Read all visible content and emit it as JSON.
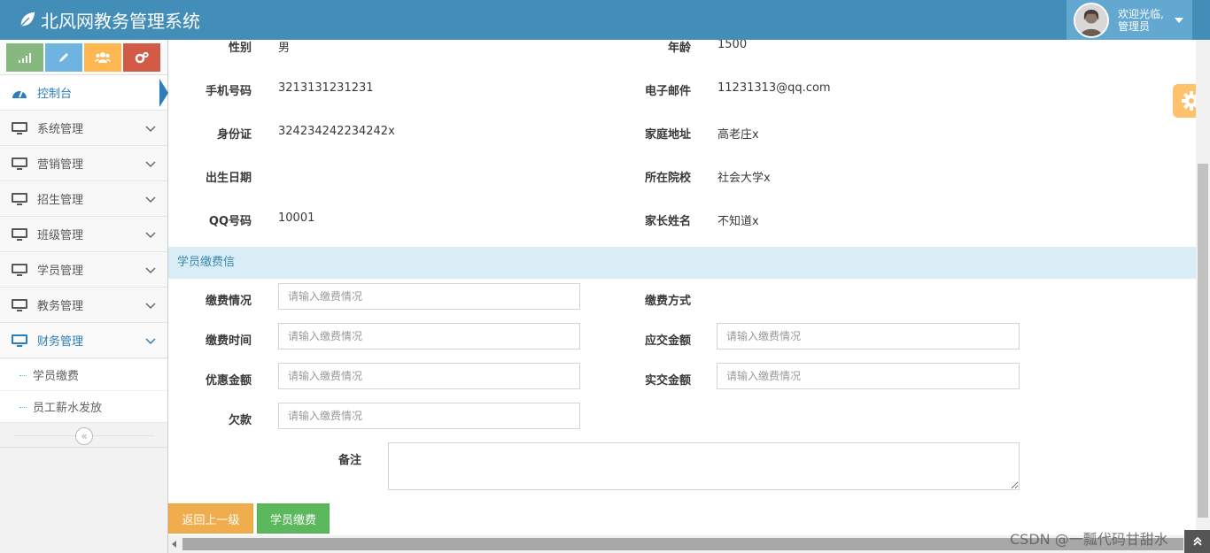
{
  "app": {
    "title": "北风网教务管理系统"
  },
  "user": {
    "greeting": "欢迎光临,",
    "role": "管理员"
  },
  "sidebar": {
    "items": [
      {
        "label": "控制台"
      },
      {
        "label": "系统管理"
      },
      {
        "label": "营销管理"
      },
      {
        "label": "招生管理"
      },
      {
        "label": "班级管理"
      },
      {
        "label": "学员管理"
      },
      {
        "label": "教务管理"
      },
      {
        "label": "财务管理"
      }
    ],
    "submenu": [
      {
        "label": "学员缴费"
      },
      {
        "label": "员工薪水发放"
      }
    ],
    "collapse_glyph": "«"
  },
  "student": {
    "gender_label": "性别",
    "gender_value": "男",
    "age_label": "年龄",
    "age_value": "1500",
    "phone_label": "手机号码",
    "phone_value": "3213131231231",
    "email_label": "电子邮件",
    "email_value": "11231313@qq.com",
    "id_label": "身份证",
    "id_value": "324234242234242x",
    "address_label": "家庭地址",
    "address_value": "高老庄x",
    "birth_label": "出生日期",
    "birth_value": "",
    "school_label": "所在院校",
    "school_value": "社会大学x",
    "qq_label": "QQ号码",
    "qq_value": "10001",
    "parent_label": "家长姓名",
    "parent_value": "不知道x"
  },
  "payment": {
    "section_title": "学员缴费信",
    "status_label": "缴费情况",
    "method_label": "缴费方式",
    "time_label": "缴费时间",
    "due_label": "应交金额",
    "discount_label": "优惠金额",
    "paid_label": "实交金额",
    "debt_label": "欠款",
    "note_label": "备注",
    "placeholder": "请输入缴费情况"
  },
  "buttons": {
    "back": "返回上一级",
    "pay": "学员缴费"
  },
  "watermark": "CSDN @一瓢代码甘甜水",
  "colors": {
    "navbar": "#438eb9",
    "accent": "#2b7dbc",
    "section_bg": "#d9edf7"
  }
}
